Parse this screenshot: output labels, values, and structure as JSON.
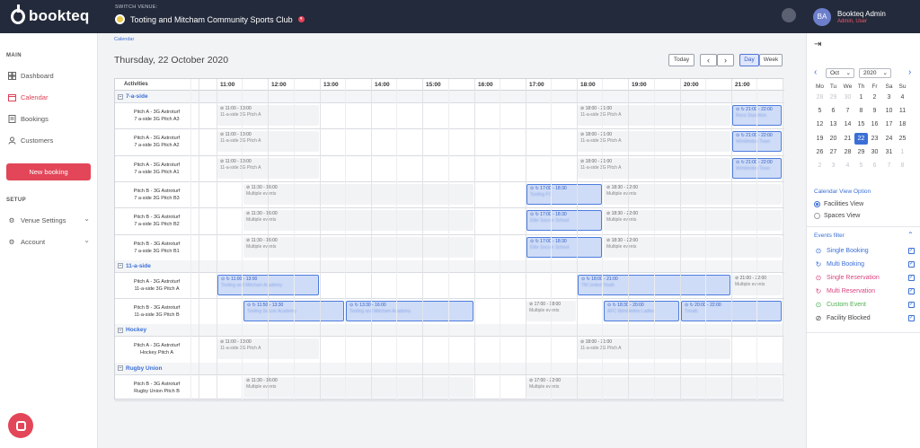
{
  "app": {
    "logo": "bookteq"
  },
  "venue": {
    "switch_label": "SWITCH VENUE:",
    "name": "Tooting and Mitcham Community Sports Club"
  },
  "user": {
    "initials": "BA",
    "name": "Bookteq Admin",
    "role": "Admin, User"
  },
  "sidebar": {
    "main_heading": "MAIN",
    "items": [
      {
        "label": "Dashboard",
        "icon": "dashboard-icon"
      },
      {
        "label": "Calendar",
        "icon": "calendar-icon"
      },
      {
        "label": "Bookings",
        "icon": "bookings-icon"
      },
      {
        "label": "Customers",
        "icon": "customers-icon"
      }
    ],
    "new_booking": "New booking",
    "setup_heading": "SETUP",
    "setup_items": [
      {
        "label": "Venue Settings",
        "icon": "gear-icon"
      },
      {
        "label": "Account",
        "icon": "gear-icon"
      }
    ]
  },
  "main": {
    "breadcrumb": "Calendar",
    "date_title": "Thursday, 22 October 2020",
    "today_button": "Today",
    "prev_button": "‹",
    "next_button": "›",
    "day_button": "Day",
    "week_button": "Week"
  },
  "grid": {
    "activities_header": "Activities",
    "hours": [
      "11:00",
      "12:00",
      "13:00",
      "14:00",
      "15:00",
      "16:00",
      "17:00",
      "18:00",
      "19:00",
      "20:00",
      "21:00"
    ],
    "groups": [
      {
        "label": "7-a-side",
        "rows": [
          {
            "line1": "Pitch A - 3G Astroturf",
            "line2": "7 a-side 3G Pitch A3",
            "events": [
              {
                "type": "blocked",
                "start": 11,
                "end": 13,
                "time": "11:00 - 13:00",
                "desc": "11-a-side 3G Pitch A"
              },
              {
                "type": "blocked",
                "start": 18,
                "end": 21,
                "time": "18:00 - 21:00",
                "desc": "11-a-side 3G Pitch A"
              },
              {
                "type": "booking",
                "start": 21,
                "end": 22,
                "time": "21:00 - 22:00",
                "desc": "Roco Stadetion"
              }
            ]
          },
          {
            "line1": "Pitch A - 3G Astroturf",
            "line2": "7 a-side 3G Pitch A2",
            "events": [
              {
                "type": "blocked",
                "start": 11,
                "end": 13,
                "time": "11:00 - 13:00",
                "desc": "11-a-side 3G Pitch A"
              },
              {
                "type": "blocked",
                "start": 18,
                "end": 21,
                "time": "18:00 - 21:00",
                "desc": "11-a-side 3G Pitch A"
              },
              {
                "type": "booking",
                "start": 21,
                "end": 22,
                "time": "21:00 - 22:00",
                "desc": "Wimbledon Town"
              }
            ]
          },
          {
            "line1": "Pitch A - 3G Astroturf",
            "line2": "7 a-side 3G Pitch A1",
            "events": [
              {
                "type": "blocked",
                "start": 11,
                "end": 13,
                "time": "11:00 - 13:00",
                "desc": "11-a-side 3G Pitch A"
              },
              {
                "type": "blocked",
                "start": 18,
                "end": 21,
                "time": "18:00 - 21:00",
                "desc": "11-a-side 3G Pitch A"
              },
              {
                "type": "booking",
                "start": 21,
                "end": 22,
                "time": "21:00 - 22:00",
                "desc": "Wimbledon Town"
              }
            ]
          },
          {
            "line1": "Pitch B - 3G Astroturf",
            "line2": "7 a-side 3G Pitch B3",
            "events": [
              {
                "type": "blocked",
                "start": 11.5,
                "end": 16,
                "time": "11:30 - 16:00",
                "desc": "Multiple events"
              },
              {
                "type": "booking",
                "start": 17,
                "end": 18.5,
                "time": "17:00 - 18:30",
                "desc": "Tooting FC"
              },
              {
                "type": "blocked",
                "start": 18.5,
                "end": 22,
                "time": "18:30 - 22:00",
                "desc": "Multiple events"
              }
            ]
          },
          {
            "line1": "Pitch B - 3G Astroturf",
            "line2": "7 a-side 3G Pitch B2",
            "events": [
              {
                "type": "blocked",
                "start": 11.5,
                "end": 16,
                "time": "11:30 - 16:00",
                "desc": "Multiple events"
              },
              {
                "type": "booking",
                "start": 17,
                "end": 18.5,
                "time": "17:00 - 18:30",
                "desc": "Elite Soccer School"
              },
              {
                "type": "blocked",
                "start": 18.5,
                "end": 22,
                "time": "18:30 - 22:00",
                "desc": "Multiple events"
              }
            ]
          },
          {
            "line1": "Pitch B - 3G Astroturf",
            "line2": "7 a-side 3G Pitch B1",
            "events": [
              {
                "type": "blocked",
                "start": 11.5,
                "end": 16,
                "time": "11:30 - 16:00",
                "desc": "Multiple events"
              },
              {
                "type": "booking",
                "start": 17,
                "end": 18.5,
                "time": "17:00 - 18:30",
                "desc": "Elite Soccer School"
              },
              {
                "type": "blocked",
                "start": 18.5,
                "end": 22,
                "time": "18:30 - 22:00",
                "desc": "Multiple events"
              }
            ]
          }
        ]
      },
      {
        "label": "11-a-side",
        "rows": [
          {
            "line1": "Pitch A - 3G Astroturf",
            "line2": "11-a-side 3G Pitch A",
            "events": [
              {
                "type": "booking",
                "start": 11,
                "end": 13,
                "time": "11:00 - 13:00",
                "desc": "Tooting and Mitcham Academy"
              },
              {
                "type": "booking",
                "start": 18,
                "end": 21,
                "time": "18:00 - 21:00",
                "desc": "TM United Youth"
              },
              {
                "type": "blocked",
                "start": 21,
                "end": 22,
                "time": "21:00 - 22:00",
                "desc": "Multiple events"
              }
            ]
          },
          {
            "line1": "Pitch B - 3G Astroturf",
            "line2": "11-a-side 3G Pitch B",
            "events": [
              {
                "type": "booking",
                "start": 11.5,
                "end": 13.5,
                "time": "11:50 - 13:30",
                "desc": "Tooting Soccer Academy"
              },
              {
                "type": "booking",
                "start": 13.5,
                "end": 16,
                "time": "13:30 - 16:00",
                "desc": "Tooting and Mitcham Academy"
              },
              {
                "type": "blocked",
                "start": 17,
                "end": 18,
                "time": "17:00 - 18:00",
                "desc": "Multiple events"
              },
              {
                "type": "booking",
                "start": 18.5,
                "end": 20,
                "time": "18:30 - 20:00",
                "desc": "AFC Wimbledon Ladies"
              },
              {
                "type": "booking",
                "start": 20,
                "end": 22,
                "time": "20:00 - 22:00",
                "desc": "Tmuitc"
              }
            ]
          }
        ]
      },
      {
        "label": "Hockey",
        "rows": [
          {
            "line1": "Pitch A - 3G Astroturf",
            "line2": "Hockey Pitch A",
            "events": [
              {
                "type": "blocked",
                "start": 11,
                "end": 13,
                "time": "11:00 - 13:00",
                "desc": "11-a-side 3G Pitch A"
              },
              {
                "type": "blocked",
                "start": 18,
                "end": 21,
                "time": "18:00 - 21:00",
                "desc": "11-a-side 3G Pitch A"
              }
            ]
          }
        ]
      },
      {
        "label": "Rugby Union",
        "rows": [
          {
            "line1": "Pitch B - 3G Astroturf",
            "line2": "Rugby Union Pitch B",
            "events": [
              {
                "type": "blocked",
                "start": 11.5,
                "end": 16,
                "time": "11:30 - 16:00",
                "desc": "Multiple events"
              },
              {
                "type": "blocked",
                "start": 17,
                "end": 22,
                "time": "17:00 - 22:00",
                "desc": "Multiple events"
              }
            ]
          }
        ]
      }
    ]
  },
  "mini_calendar": {
    "month": "Oct",
    "year": "2020",
    "weekdays": [
      "Mo",
      "Tu",
      "We",
      "Th",
      "Fr",
      "Sa",
      "Su"
    ],
    "weeks": [
      [
        {
          "d": "28",
          "m": true
        },
        {
          "d": "29",
          "m": true
        },
        {
          "d": "30",
          "m": true
        },
        {
          "d": "1"
        },
        {
          "d": "2"
        },
        {
          "d": "3"
        },
        {
          "d": "4"
        }
      ],
      [
        {
          "d": "5"
        },
        {
          "d": "6"
        },
        {
          "d": "7"
        },
        {
          "d": "8"
        },
        {
          "d": "9"
        },
        {
          "d": "10"
        },
        {
          "d": "11"
        }
      ],
      [
        {
          "d": "12"
        },
        {
          "d": "13"
        },
        {
          "d": "14"
        },
        {
          "d": "15"
        },
        {
          "d": "16"
        },
        {
          "d": "17"
        },
        {
          "d": "18"
        }
      ],
      [
        {
          "d": "19"
        },
        {
          "d": "20"
        },
        {
          "d": "21"
        },
        {
          "d": "22",
          "t": true
        },
        {
          "d": "23"
        },
        {
          "d": "24"
        },
        {
          "d": "25"
        }
      ],
      [
        {
          "d": "26"
        },
        {
          "d": "27"
        },
        {
          "d": "28"
        },
        {
          "d": "29"
        },
        {
          "d": "30"
        },
        {
          "d": "31"
        },
        {
          "d": "1",
          "m": true
        }
      ],
      [
        {
          "d": "2",
          "m": true
        },
        {
          "d": "3",
          "m": true
        },
        {
          "d": "4",
          "m": true
        },
        {
          "d": "5",
          "m": true
        },
        {
          "d": "6",
          "m": true
        },
        {
          "d": "7",
          "m": true
        },
        {
          "d": "8",
          "m": true
        }
      ]
    ]
  },
  "view_options": {
    "title": "Calendar View Option",
    "options": [
      {
        "label": "Facilities View",
        "selected": true
      },
      {
        "label": "Spaces View",
        "selected": false
      }
    ]
  },
  "events_filter": {
    "title": "Events filter",
    "items": [
      {
        "label": "Single Booking",
        "color": "#3a6fd6",
        "icon": "single-booking-icon",
        "glyph": "⊙"
      },
      {
        "label": "Multi Booking",
        "color": "#3a6fd6",
        "icon": "multi-booking-icon",
        "glyph": "↻"
      },
      {
        "label": "Single Reservation",
        "color": "#d9457f",
        "icon": "single-reservation-icon",
        "glyph": "⊙"
      },
      {
        "label": "Multi Reservation",
        "color": "#d9457f",
        "icon": "multi-reservation-icon",
        "glyph": "↻"
      },
      {
        "label": "Custom Event",
        "color": "#4caf50",
        "icon": "custom-event-icon",
        "glyph": "⊙"
      },
      {
        "label": "Facility Blocked",
        "color": "#444444",
        "icon": "facility-blocked-icon",
        "glyph": "⊘"
      }
    ]
  }
}
